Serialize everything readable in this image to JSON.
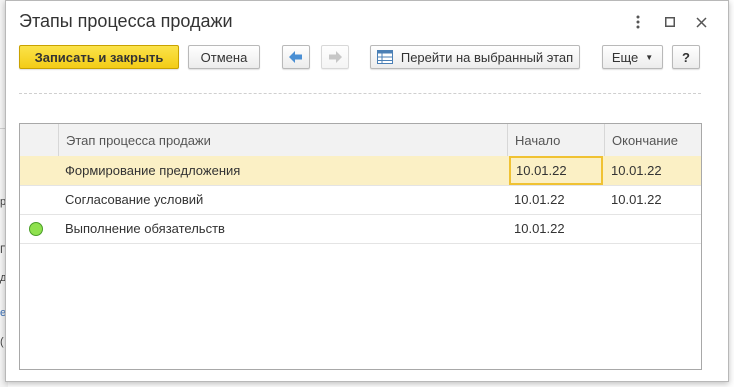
{
  "background_fragments": [
    "р",
    "П",
    "д",
    "е",
    "("
  ],
  "window": {
    "title": "Этапы процесса продажи",
    "menu_icon": "more-vertical-icon",
    "maximize_icon": "maximize-icon",
    "close_icon": "close-icon"
  },
  "toolbar": {
    "save_close_label": "Записать и закрыть",
    "cancel_label": "Отмена",
    "back_icon": "arrow-left-icon",
    "forward_icon": "arrow-right-icon",
    "goto_stage_label": "Перейти на выбранный этап",
    "goto_stage_icon": "table-icon",
    "more_label": "Еще",
    "help_label": "?"
  },
  "table": {
    "columns": [
      "Этап процесса продажи",
      "Начало",
      "Окончание"
    ],
    "rows": [
      {
        "stage": "Формирование предложения",
        "start": "10.01.22",
        "end": "10.01.22",
        "selected": true,
        "status": ""
      },
      {
        "stage": "Согласование условий",
        "start": "10.01.22",
        "end": "10.01.22",
        "selected": false,
        "status": ""
      },
      {
        "stage": "Выполнение обязательств",
        "start": "10.01.22",
        "end": "",
        "selected": false,
        "status": "current"
      }
    ]
  },
  "colors": {
    "primary_button": "#f3cc16",
    "selected_row": "#fbf0c5",
    "focus_border": "#f0c233",
    "status_current": "#8fe14e",
    "nav_arrow": "#4a8fd4"
  }
}
